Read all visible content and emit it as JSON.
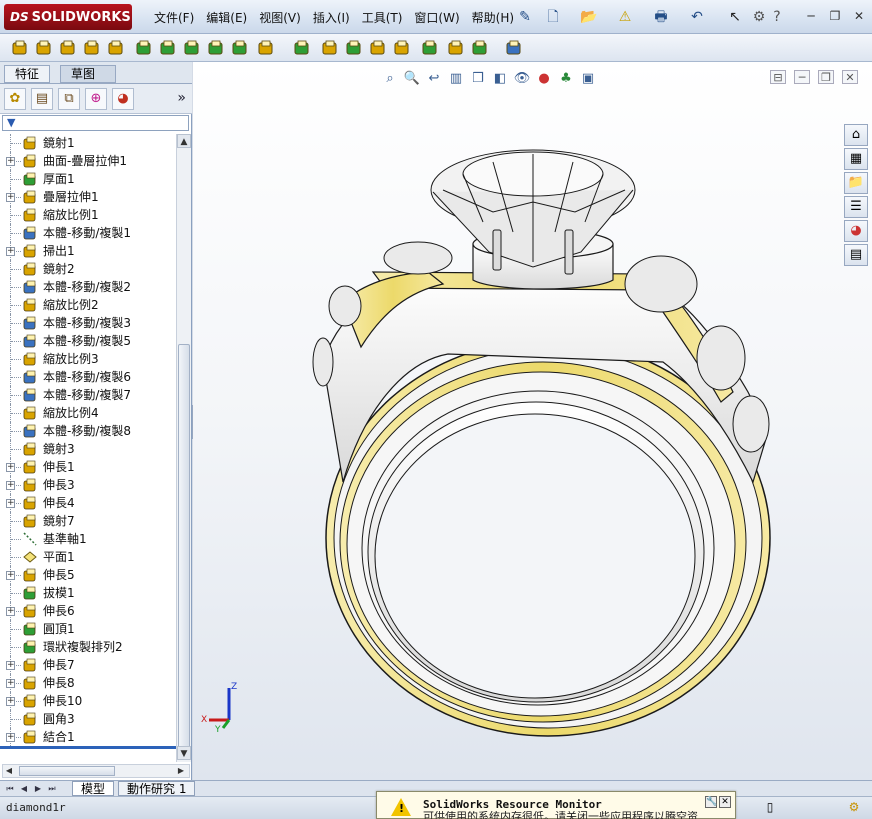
{
  "app": {
    "brand": "SOLIDWORKS",
    "brand_prefix": "DS"
  },
  "menu": [
    "文件(F)",
    "编辑(E)",
    "视图(V)",
    "插入(I)",
    "工具(T)",
    "窗口(W)",
    "帮助(H)"
  ],
  "quick_icons": [
    "pin-icon",
    "new-doc-icon",
    "open-icon",
    "rebuild-warning-icon",
    "print-icon",
    "undo-icon",
    "select-icon",
    "options-icon",
    "help-icon"
  ],
  "window_controls": [
    "minimize",
    "restore",
    "close"
  ],
  "feature_toolbar": [
    "extrude-boss",
    "revolve",
    "sweep",
    "loft",
    "boundary",
    "extrude-cut",
    "revolve-cut",
    "sweep-cut",
    "loft-cut",
    "boundary-cut",
    "fillet",
    "linear-pattern",
    "rib",
    "draft",
    "shell",
    "wrap",
    "dome",
    "reference-geometry",
    "curves",
    "instant3d"
  ],
  "panel": {
    "tabs": [
      {
        "label": "特征",
        "active": false
      },
      {
        "label": "草图",
        "active": true
      }
    ],
    "panel_icons": [
      "feature-manager-icon",
      "property-manager-icon",
      "configuration-manager-icon",
      "dimxpert-icon",
      "display-manager-icon"
    ],
    "more": "»",
    "tree": [
      {
        "label": "鏡射1",
        "icon": "mirror",
        "expandable": false
      },
      {
        "label": "曲面-疊層拉伸1",
        "icon": "loft-surface",
        "expandable": true
      },
      {
        "label": "厚面1",
        "icon": "thicken",
        "expandable": false
      },
      {
        "label": "疊層拉伸1",
        "icon": "loft",
        "expandable": true
      },
      {
        "label": "縮放比例1",
        "icon": "scale",
        "expandable": false
      },
      {
        "label": "本體-移動/複製1",
        "icon": "move",
        "expandable": false
      },
      {
        "label": "掃出1",
        "icon": "sweep",
        "expandable": true
      },
      {
        "label": "鏡射2",
        "icon": "mirror-body",
        "expandable": false
      },
      {
        "label": "本體-移動/複製2",
        "icon": "move",
        "expandable": false
      },
      {
        "label": "縮放比例2",
        "icon": "scale",
        "expandable": false
      },
      {
        "label": "本體-移動/複製3",
        "icon": "move",
        "expandable": false
      },
      {
        "label": "本體-移動/複製5",
        "icon": "move",
        "expandable": false
      },
      {
        "label": "縮放比例3",
        "icon": "scale",
        "expandable": false
      },
      {
        "label": "本體-移動/複製6",
        "icon": "move",
        "expandable": false
      },
      {
        "label": "本體-移動/複製7",
        "icon": "move",
        "expandable": false
      },
      {
        "label": "縮放比例4",
        "icon": "scale",
        "expandable": false
      },
      {
        "label": "本體-移動/複製8",
        "icon": "move",
        "expandable": false
      },
      {
        "label": "鏡射3",
        "icon": "mirror-body",
        "expandable": false
      },
      {
        "label": "伸長1",
        "icon": "extrude",
        "expandable": true
      },
      {
        "label": "伸長3",
        "icon": "extrude",
        "expandable": true
      },
      {
        "label": "伸長4",
        "icon": "extrude",
        "expandable": true
      },
      {
        "label": "鏡射7",
        "icon": "mirror-body",
        "expandable": false
      },
      {
        "label": "基準軸1",
        "icon": "axis",
        "expandable": false
      },
      {
        "label": "平面1",
        "icon": "plane",
        "expandable": false
      },
      {
        "label": "伸長5",
        "icon": "extrude",
        "expandable": true
      },
      {
        "label": "拔模1",
        "icon": "draft",
        "expandable": false
      },
      {
        "label": "伸長6",
        "icon": "extrude",
        "expandable": true
      },
      {
        "label": "圓頂1",
        "icon": "dome",
        "expandable": false
      },
      {
        "label": "環狀複製排列2",
        "icon": "circular-pattern",
        "expandable": false
      },
      {
        "label": "伸長7",
        "icon": "extrude",
        "expandable": true
      },
      {
        "label": "伸長8",
        "icon": "extrude",
        "expandable": true
      },
      {
        "label": "伸長10",
        "icon": "extrude",
        "expandable": true
      },
      {
        "label": "圓角3",
        "icon": "fillet",
        "expandable": false
      },
      {
        "label": "結合1",
        "icon": "combine",
        "expandable": true
      }
    ]
  },
  "viewport": {
    "heads_up_icons": [
      "zoom-to-fit-icon",
      "zoom-area-icon",
      "previous-view-icon",
      "section-view-icon",
      "view-orientation-icon",
      "display-style-icon",
      "hide-show-icon",
      "edit-appearance-icon",
      "apply-scene-icon",
      "view-settings-icon"
    ],
    "task_pane_icons": [
      "home-icon",
      "design-library-icon",
      "file-explorer-icon",
      "view-palette-icon",
      "appearances-icon",
      "custom-properties-icon"
    ],
    "triad_labels": {
      "x": "X",
      "y": "Y",
      "z": "Z"
    },
    "colors": {
      "metal_yellow": "#ecd96a",
      "metal_white": "#f2f2f2",
      "outline": "#1a1a1a"
    }
  },
  "bottom_tabs": [
    {
      "label": "模型",
      "active": true
    },
    {
      "label": "動作研究 1",
      "active": false
    }
  ],
  "status": {
    "filename": "diamond1r"
  },
  "notice": {
    "title": "SolidWorks Resource Monitor",
    "message": "可供使用的系统内存很低。请关闭一些应用程序以腾空资"
  }
}
